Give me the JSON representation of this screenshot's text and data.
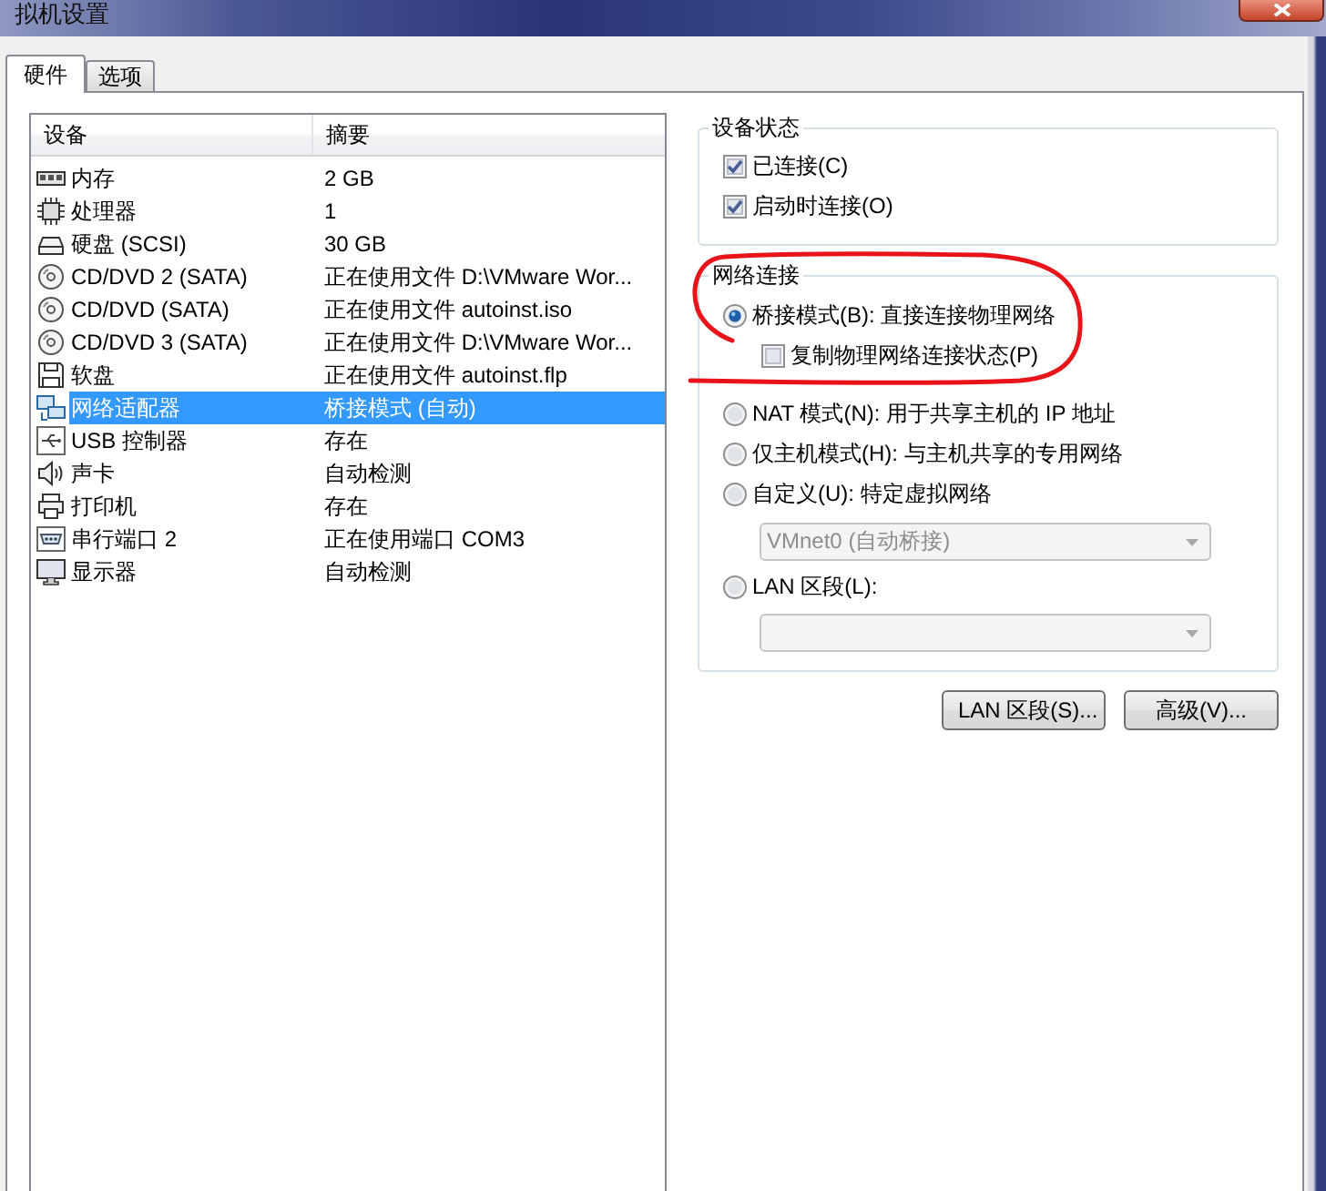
{
  "window": {
    "title": "拟机设置"
  },
  "tabs": [
    {
      "label": "硬件",
      "selected": true
    },
    {
      "label": "选项",
      "selected": false
    }
  ],
  "device_list": {
    "columns": [
      "设备",
      "摘要"
    ],
    "rows": [
      {
        "kind": "memory",
        "device": "内存",
        "summary": "2 GB",
        "selected": false
      },
      {
        "kind": "processor",
        "device": "处理器",
        "summary": "1",
        "selected": false
      },
      {
        "kind": "disk",
        "device": "硬盘 (SCSI)",
        "summary": "30 GB",
        "selected": false
      },
      {
        "kind": "cd",
        "device": "CD/DVD 2 (SATA)",
        "summary": "正在使用文件 D:\\VMware Wor...",
        "selected": false
      },
      {
        "kind": "cd",
        "device": "CD/DVD (SATA)",
        "summary": "正在使用文件 autoinst.iso",
        "selected": false
      },
      {
        "kind": "cd",
        "device": "CD/DVD 3 (SATA)",
        "summary": "正在使用文件 D:\\VMware Wor...",
        "selected": false
      },
      {
        "kind": "floppy",
        "device": "软盘",
        "summary": "正在使用文件 autoinst.flp",
        "selected": false
      },
      {
        "kind": "network",
        "device": "网络适配器",
        "summary": "桥接模式 (自动)",
        "selected": true
      },
      {
        "kind": "usb",
        "device": "USB 控制器",
        "summary": "存在",
        "selected": false
      },
      {
        "kind": "sound",
        "device": "声卡",
        "summary": "自动检测",
        "selected": false
      },
      {
        "kind": "printer",
        "device": "打印机",
        "summary": "存在",
        "selected": false
      },
      {
        "kind": "serial",
        "device": "串行端口 2",
        "summary": "正在使用端口 COM3",
        "selected": false
      },
      {
        "kind": "display",
        "device": "显示器",
        "summary": "自动检测",
        "selected": false
      }
    ]
  },
  "device_status": {
    "title": "设备状态",
    "options": [
      {
        "label": "已连接(C)",
        "checked": true
      },
      {
        "label": "启动时连接(O)",
        "checked": true
      }
    ]
  },
  "network_connection": {
    "title": "网络连接",
    "modes": [
      {
        "label": "桥接模式(B): 直接连接物理网络",
        "selected": true,
        "suboption": {
          "label": "复制物理网络连接状态(P)",
          "checked": false
        }
      },
      {
        "label": "NAT 模式(N): 用于共享主机的 IP 地址",
        "selected": false
      },
      {
        "label": "仅主机模式(H): 与主机共享的专用网络",
        "selected": false
      },
      {
        "label": "自定义(U): 特定虚拟网络",
        "selected": false,
        "dropdown": {
          "value": "VMnet0 (自动桥接)",
          "disabled": true
        }
      },
      {
        "label": "LAN 区段(L):",
        "selected": false,
        "dropdown": {
          "disabled": true
        }
      }
    ]
  },
  "buttons": [
    {
      "label": "LAN 区段(S)..."
    },
    {
      "label": "高级(V)..."
    }
  ],
  "annotation": {
    "kind": "circle"
  }
}
